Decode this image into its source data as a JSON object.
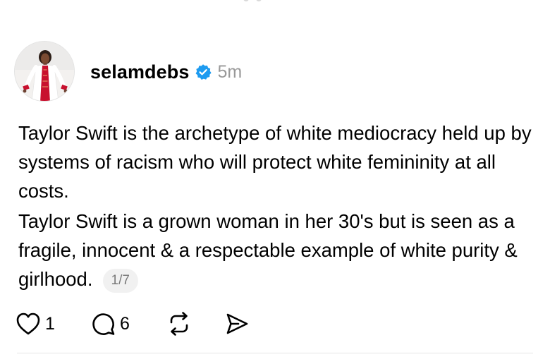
{
  "post": {
    "author": {
      "username": "selamdebs",
      "verified": true
    },
    "timestamp": "5m",
    "paragraphs": [
      "Taylor Swift is the archetype of white mediocracy held up by systems of racism who will protect white femininity at all costs.",
      "Taylor Swift is a grown woman in her 30's but is seen as a fragile, innocent & a respectable example of white purity & girlhood."
    ],
    "page_indicator": "1/7",
    "actions": {
      "like_count": "1",
      "reply_count": "6"
    }
  },
  "icons": {
    "verified": "verified-check-badge",
    "like": "heart-outline",
    "reply": "speech-bubble-outline",
    "repost": "repost-arrows",
    "share": "send-paper-plane"
  },
  "colors": {
    "verified_blue": "#1d9bf0",
    "timestamp_gray": "#999999",
    "pill_bg": "#f1f1f1"
  }
}
